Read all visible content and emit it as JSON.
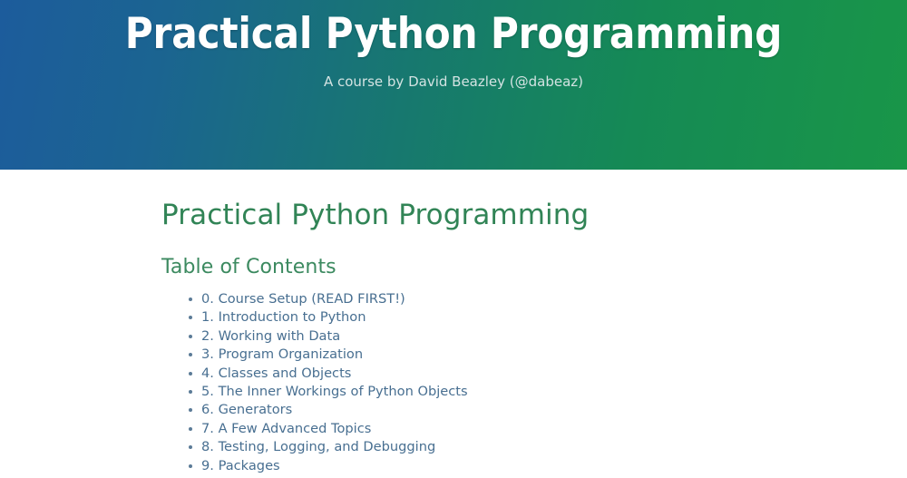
{
  "header": {
    "title": "Practical Python Programming",
    "subtitle": "A course by David Beazley (@dabeaz)",
    "gradient_from": "#1c5c9c",
    "gradient_to": "#199648"
  },
  "main": {
    "doc_title": "Practical Python Programming",
    "toc_heading": "Table of Contents",
    "toc_items": [
      {
        "label": "0. Course Setup (READ FIRST!)"
      },
      {
        "label": "1. Introduction to Python"
      },
      {
        "label": "2. Working with Data"
      },
      {
        "label": "3. Program Organization"
      },
      {
        "label": "4. Classes and Objects"
      },
      {
        "label": "5. The Inner Workings of Python Objects"
      },
      {
        "label": "6. Generators"
      },
      {
        "label": "7. A Few Advanced Topics"
      },
      {
        "label": "8. Testing, Logging, and Debugging"
      },
      {
        "label": "9. Packages"
      }
    ]
  },
  "colors": {
    "heading_green": "#318456",
    "subheading_green": "#3c8a60",
    "link_blue": "#486f91",
    "page_background": "#ffffff"
  }
}
